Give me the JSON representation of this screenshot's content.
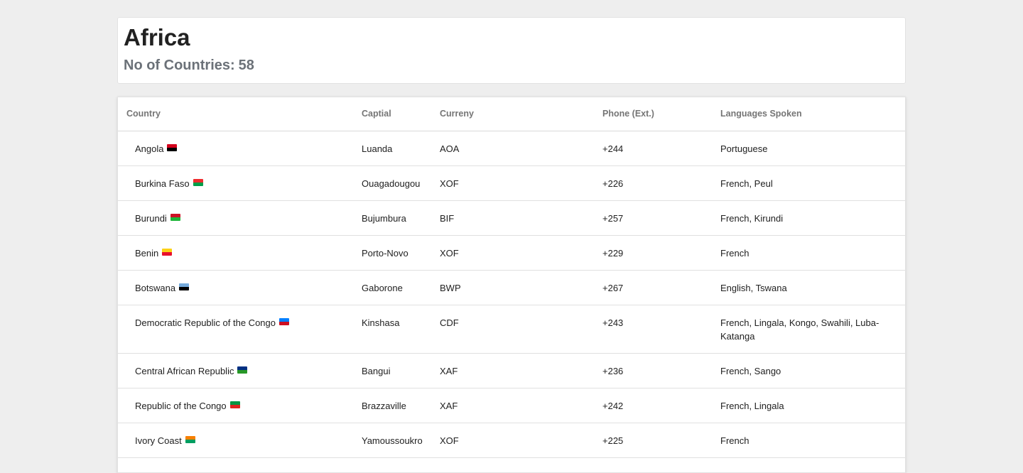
{
  "header": {
    "title": "Africa",
    "count_label": "No of Countries:",
    "count_value": "58"
  },
  "table": {
    "columns": [
      "Country",
      "Captial",
      "Curreny",
      "Phone (Ext.)",
      "Languages Spoken"
    ],
    "rows": [
      {
        "country": "Angola",
        "capital": "Luanda",
        "currency": "AOA",
        "phone": "+244",
        "languages": "Portuguese",
        "flag_colors": [
          "#d4001c",
          "#000000"
        ]
      },
      {
        "country": "Burkina Faso",
        "capital": "Ouagadougou",
        "currency": "XOF",
        "phone": "+226",
        "languages": "French, Peul",
        "flag_colors": [
          "#ef2b2d",
          "#009e49"
        ]
      },
      {
        "country": "Burundi",
        "capital": "Bujumbura",
        "currency": "BIF",
        "phone": "+257",
        "languages": "French, Kirundi",
        "flag_colors": [
          "#ce1126",
          "#1eb53a"
        ]
      },
      {
        "country": "Benin",
        "capital": "Porto-Novo",
        "currency": "XOF",
        "phone": "+229",
        "languages": "French",
        "flag_colors": [
          "#fcd116",
          "#e8112d"
        ]
      },
      {
        "country": "Botswana",
        "capital": "Gaborone",
        "currency": "BWP",
        "phone": "+267",
        "languages": "English, Tswana",
        "flag_colors": [
          "#75aadb",
          "#000000"
        ]
      },
      {
        "country": "Democratic Republic of the Congo",
        "capital": "Kinshasa",
        "currency": "CDF",
        "phone": "+243",
        "languages": "French, Lingala, Kongo, Swahili, Luba-Katanga",
        "flag_colors": [
          "#007fff",
          "#ce1021"
        ]
      },
      {
        "country": "Central African Republic",
        "capital": "Bangui",
        "currency": "XAF",
        "phone": "+236",
        "languages": "French, Sango",
        "flag_colors": [
          "#003082",
          "#289728"
        ]
      },
      {
        "country": "Republic of the Congo",
        "capital": "Brazzaville",
        "currency": "XAF",
        "phone": "+242",
        "languages": "French, Lingala",
        "flag_colors": [
          "#009543",
          "#dc241f"
        ]
      },
      {
        "country": "Ivory Coast",
        "capital": "Yamoussoukro",
        "currency": "XOF",
        "phone": "+225",
        "languages": "French",
        "flag_colors": [
          "#f77f00",
          "#009e60"
        ]
      }
    ]
  }
}
